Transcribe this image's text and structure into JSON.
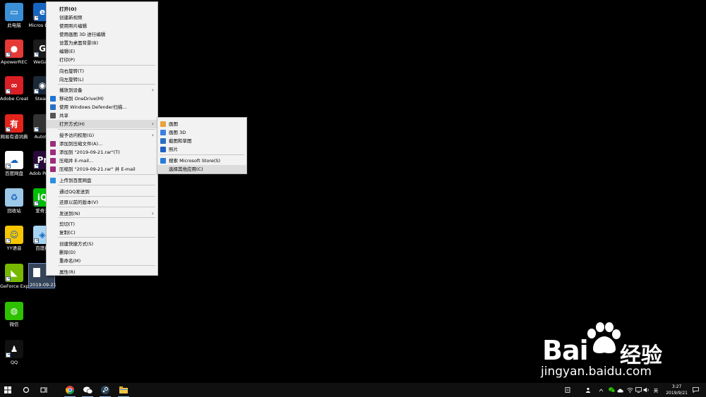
{
  "desktop_icons": [
    {
      "label": "此电脑",
      "icon": "pc-icon",
      "color": "#3b8fd6"
    },
    {
      "label": "Micros Edge",
      "icon": "edge-icon",
      "color": "#1565c0"
    },
    {
      "label": "ApowerREC",
      "icon": "record-icon",
      "color": "#e53935"
    },
    {
      "label": "WeGam",
      "icon": "wegame-icon",
      "color": "#1b1b1b"
    },
    {
      "label": "Adobe Creati...",
      "icon": "adobe-cc-icon",
      "color": "#da1f26"
    },
    {
      "label": "Steam",
      "icon": "steam-icon",
      "color": "#1b2838"
    },
    {
      "label": "网易有道词典",
      "icon": "youdao-icon",
      "color": "#e3241b"
    },
    {
      "label": "AutoSc",
      "icon": "autosc-icon",
      "color": "#333333"
    },
    {
      "label": "百度网盘",
      "icon": "baidu-netdisk-icon",
      "color": "#ffffff"
    },
    {
      "label": "Adob Premi",
      "icon": "premiere-icon",
      "color": "#2a0a3a"
    },
    {
      "label": "回收站",
      "icon": "recycle-bin-icon",
      "color": "#9ec8e8"
    },
    {
      "label": "爱奇艺",
      "icon": "iqiyi-icon",
      "color": "#00be06"
    },
    {
      "label": "YY语音",
      "icon": "yy-icon",
      "color": "#f7c600"
    },
    {
      "label": "百度经",
      "icon": "baidu-jingyan-icon",
      "color": "#a7d4f0"
    },
    {
      "label": "GeForce Experience",
      "icon": "geforce-icon",
      "color": "#76b900"
    },
    {
      "label": "微信",
      "icon": "wechat-icon",
      "color": "#2dc100"
    },
    {
      "label": "QQ",
      "icon": "qq-icon",
      "color": "#111111"
    }
  ],
  "selected_file": {
    "label": "2019-09-21"
  },
  "context_menu": {
    "items": [
      {
        "label": "打开(O)",
        "icon": "",
        "bold": true
      },
      {
        "label": "创建新视频",
        "icon": ""
      },
      {
        "label": "使用照片编辑",
        "icon": ""
      },
      {
        "label": "使用画图 3D 进行编辑",
        "icon": ""
      },
      {
        "label": "设置为桌面背景(B)",
        "icon": ""
      },
      {
        "label": "编辑(E)",
        "icon": ""
      },
      {
        "label": "打印(P)",
        "icon": ""
      },
      {
        "label": "向右旋转(T)",
        "icon": ""
      },
      {
        "label": "向左旋转(L)",
        "icon": ""
      },
      {
        "label": "播放到设备",
        "icon": "",
        "submenu": true
      },
      {
        "label": "移动到 OneDrive(M)",
        "icon": "onedrive-icon"
      },
      {
        "label": "使用 Windows Defender扫描...",
        "icon": "defender-icon"
      },
      {
        "label": "共享",
        "icon": "share-icon"
      },
      {
        "label": "打开方式(H)",
        "icon": "",
        "submenu": true,
        "highlighted": true
      },
      {
        "label": "授予访问权限(G)",
        "icon": "",
        "submenu": true
      },
      {
        "label": "添加到压缩文件(A)...",
        "icon": "winrar-icon"
      },
      {
        "label": "添加到 \"2019-09-21.rar\"(T)",
        "icon": "winrar-icon"
      },
      {
        "label": "压缩并 E-mail...",
        "icon": "winrar-icon"
      },
      {
        "label": "压缩到 \"2019-09-21.rar\" 并 E-mail",
        "icon": "winrar-icon"
      },
      {
        "label": "上传到百度网盘",
        "icon": "baidu-netdisk-icon"
      },
      {
        "label": "通过QQ发送到",
        "icon": ""
      },
      {
        "label": "还原以前的版本(V)",
        "icon": ""
      },
      {
        "label": "发送到(N)",
        "icon": "",
        "submenu": true
      },
      {
        "label": "剪切(T)",
        "icon": ""
      },
      {
        "label": "复制(C)",
        "icon": ""
      },
      {
        "label": "创建快捷方式(S)",
        "icon": ""
      },
      {
        "label": "删除(D)",
        "icon": ""
      },
      {
        "label": "重命名(M)",
        "icon": ""
      },
      {
        "label": "属性(R)",
        "icon": ""
      }
    ]
  },
  "open_with_submenu": {
    "items": [
      {
        "label": "画图",
        "icon": "paint-icon"
      },
      {
        "label": "画图 3D",
        "icon": "paint3d-icon"
      },
      {
        "label": "截图和草图",
        "icon": "snip-sketch-icon"
      },
      {
        "label": "照片",
        "icon": "photos-icon"
      },
      {
        "label": "搜索 Microsoft Store(S)",
        "icon": "store-icon"
      },
      {
        "label": "选择其他应用(C)",
        "icon": "",
        "highlighted": true
      }
    ]
  },
  "taskbar": {
    "apps": [
      "start-icon",
      "search-icon",
      "task-view-icon",
      "chrome-icon",
      "wechat-icon",
      "steam-icon",
      "file-explorer-icon"
    ],
    "tray": {
      "ime": "英",
      "time": "3:27",
      "date": "2019/9/21"
    }
  },
  "watermark": {
    "brand": "Bai",
    "brand_cn": "经验",
    "url": "jingyan.baidu.com"
  },
  "colors": {
    "menu_bg": "#f2f2f2",
    "menu_highlight": "#dcdcdc",
    "selection": "#6e8fc8"
  }
}
